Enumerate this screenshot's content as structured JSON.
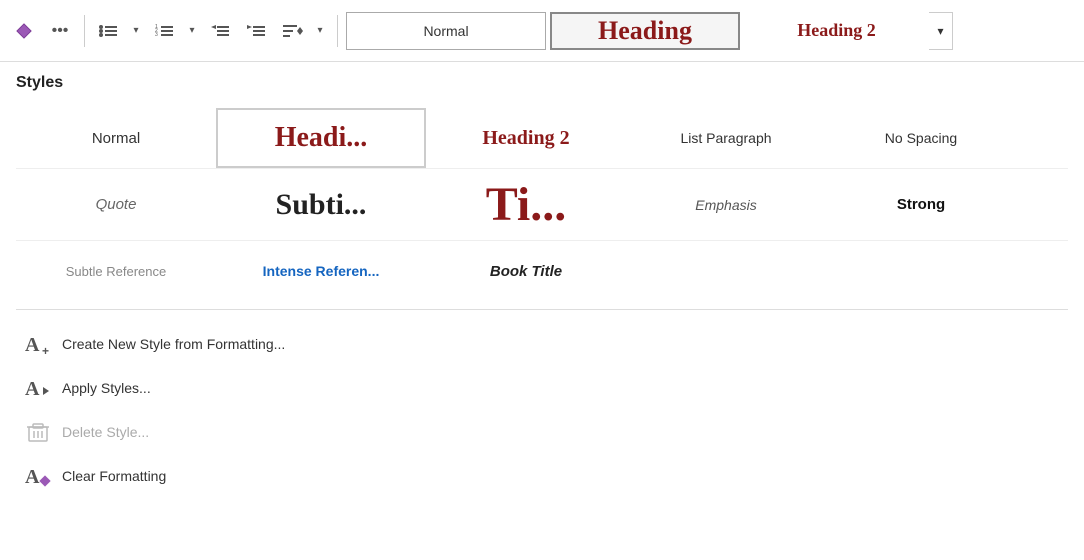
{
  "toolbar": {
    "more_icon": "•••",
    "styles_normal": "Normal",
    "styles_heading": "Heading",
    "styles_heading2": "Heading 2",
    "chevron_down": "▾"
  },
  "panel": {
    "title": "Styles",
    "styles": {
      "row1": [
        {
          "id": "normal",
          "label": "Normal",
          "type": "normal"
        },
        {
          "id": "heading",
          "label": "Headi...",
          "type": "heading-selected"
        },
        {
          "id": "heading2",
          "label": "Heading 2",
          "type": "heading2"
        },
        {
          "id": "list-paragraph",
          "label": "List Paragraph",
          "type": "list-para"
        },
        {
          "id": "no-spacing",
          "label": "No Spacing",
          "type": "no-spacing"
        }
      ],
      "row2": [
        {
          "id": "quote",
          "label": "Quote",
          "type": "quote"
        },
        {
          "id": "subtitle",
          "label": "Subti...",
          "type": "subtitle"
        },
        {
          "id": "title-large",
          "label": "Ti...",
          "type": "title-large"
        },
        {
          "id": "emphasis",
          "label": "Emphasis",
          "type": "emphasis"
        },
        {
          "id": "strong",
          "label": "Strong",
          "type": "strong"
        }
      ],
      "row3": [
        {
          "id": "subtle-ref",
          "label": "Subtle Reference",
          "type": "subtle-ref"
        },
        {
          "id": "intense-ref",
          "label": "Intense Referen...",
          "type": "intense-ref"
        },
        {
          "id": "book-title",
          "label": "Book Title",
          "type": "book-title"
        }
      ]
    },
    "actions": [
      {
        "id": "create-new",
        "label": "Create New Style from Formatting...",
        "icon": "A+",
        "disabled": false
      },
      {
        "id": "apply-styles",
        "label": "Apply Styles...",
        "icon": "A→",
        "disabled": false
      },
      {
        "id": "delete-style",
        "label": "Delete Style...",
        "icon": "🗑",
        "disabled": true
      },
      {
        "id": "clear-formatting",
        "label": "Clear Formatting",
        "icon": "A◆",
        "disabled": false
      }
    ]
  }
}
